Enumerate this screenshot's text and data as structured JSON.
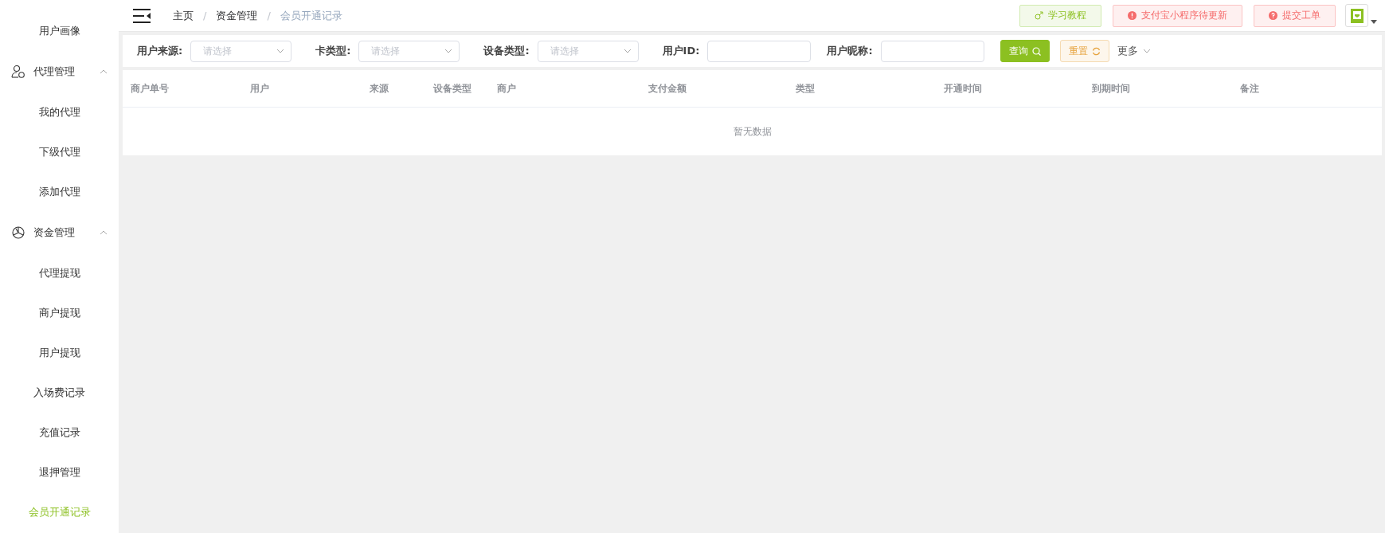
{
  "sidebar": {
    "items": [
      {
        "kind": "link",
        "label": "用户画像",
        "selected": false
      },
      {
        "kind": "group",
        "label": "代理管理",
        "expanded": true,
        "children": [
          {
            "kind": "link",
            "label": "我的代理",
            "selected": false
          },
          {
            "kind": "link",
            "label": "下级代理",
            "selected": false
          },
          {
            "kind": "link",
            "label": "添加代理",
            "selected": false
          }
        ]
      },
      {
        "kind": "group",
        "label": "资金管理",
        "expanded": true,
        "children": [
          {
            "kind": "link",
            "label": "代理提现",
            "selected": false
          },
          {
            "kind": "link",
            "label": "商户提现",
            "selected": false
          },
          {
            "kind": "link",
            "label": "用户提现",
            "selected": false
          },
          {
            "kind": "link",
            "label": "入场费记录",
            "selected": false
          },
          {
            "kind": "link",
            "label": "充值记录",
            "selected": false
          },
          {
            "kind": "link",
            "label": "退押管理",
            "selected": false
          },
          {
            "kind": "link",
            "label": "会员开通记录",
            "selected": true
          }
        ]
      }
    ]
  },
  "header": {
    "breadcrumb": [
      "主页",
      "资金管理",
      "会员开通记录"
    ],
    "breadcrumb_separator": "/",
    "buttons": [
      {
        "kind": "tutorial",
        "label": "学习教程"
      },
      {
        "kind": "alert",
        "label": "支付宝小程序待更新"
      },
      {
        "kind": "help",
        "label": "提交工单"
      }
    ]
  },
  "filters": {
    "fields": [
      {
        "kind": "select",
        "label": "用户来源:",
        "placeholder": "请选择"
      },
      {
        "kind": "select",
        "label": "卡类型:",
        "placeholder": "请选择"
      },
      {
        "kind": "select",
        "label": "设备类型:",
        "placeholder": "请选择"
      },
      {
        "kind": "input",
        "label": "用户ID:"
      },
      {
        "kind": "input",
        "label": "用户昵称:"
      }
    ],
    "search_button": "查询",
    "reset_button": "重置",
    "more": "更多"
  },
  "table": {
    "columns": [
      "商户单号",
      "用户",
      "来源",
      "设备类型",
      "商户",
      "支付金额",
      "类型",
      "开通时间",
      "到期时间",
      "备注"
    ],
    "empty_text": "暂无数据"
  }
}
